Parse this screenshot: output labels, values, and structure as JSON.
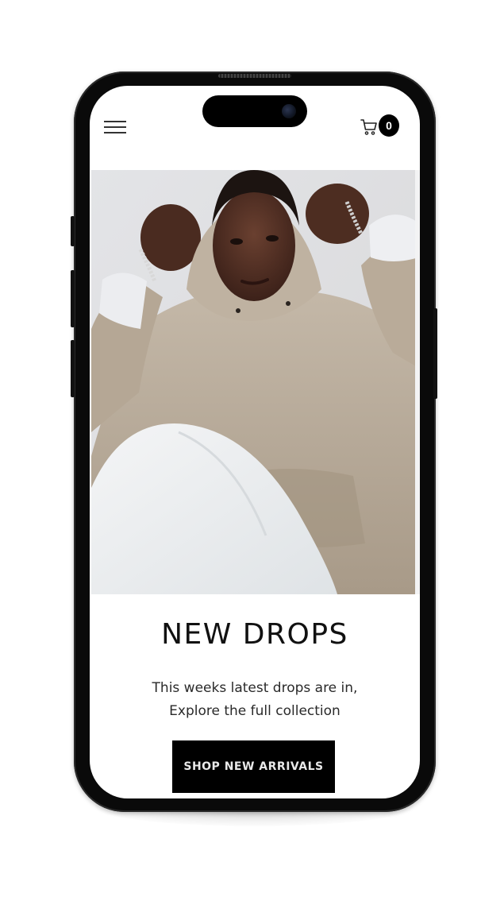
{
  "header": {
    "menu_icon": "hamburger-menu-icon",
    "cart_icon": "shopping-cart-icon",
    "cart_count": "0"
  },
  "hero": {
    "image": "model-in-beige-hoodie-photo"
  },
  "content": {
    "headline": "NEW DROPS",
    "subtext_line1": "This weeks latest drops are in,",
    "subtext_line2": "Explore the full collection",
    "cta_label": "SHOP NEW ARRIVALS"
  },
  "colors": {
    "frame": "#0a0a0a",
    "cta_background": "#000000",
    "cta_text": "#e9e9e9",
    "hoodie": "#b8ab9b"
  }
}
